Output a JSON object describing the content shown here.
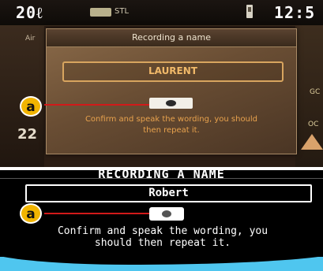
{
  "top_screen": {
    "status_bar": {
      "temperature": "20ℓ",
      "radio_label": "STL",
      "time": "12:5"
    },
    "background_left_label": "Air",
    "background_left_value": "22",
    "background_right_labels": [
      "GC",
      "OC"
    ],
    "dialog": {
      "title": "Recording a name",
      "name_value": "LAURENT",
      "instruction": "Confirm and speak the wording, you should then repeat it."
    }
  },
  "bottom_screen": {
    "title": "RECORDING A NAME",
    "name_value": "Robert",
    "instruction_line1": "Confirm and speak the wording, you",
    "instruction_line2": "should then repeat it."
  },
  "callouts": {
    "top_label": "a",
    "bottom_label": "a"
  },
  "colors": {
    "callout_badge": "#f1b400",
    "callout_line": "#d11a1a",
    "photo_accent": "#f1b969",
    "footer_band": "#4fc6ef"
  }
}
